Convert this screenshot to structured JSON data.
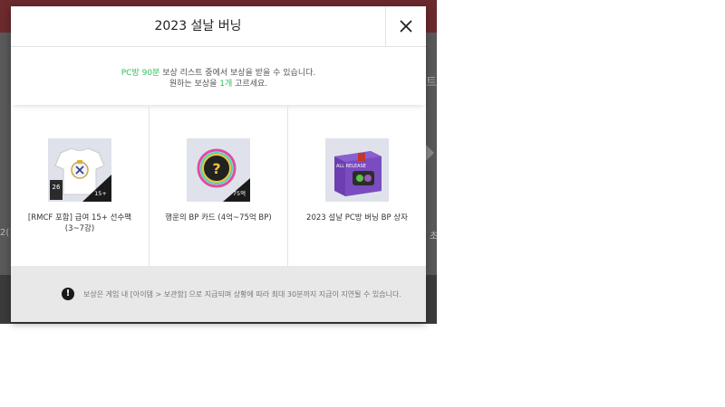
{
  "backdrop": {
    "side_glyph": "트",
    "side_text_left": "2(",
    "side_text_right": "초"
  },
  "modal": {
    "title": "2023 설날 버닝",
    "close_icon": "close-icon",
    "notice": {
      "line1_highlight": "PC방 90분",
      "line1_rest": " 보상 리스트 중에서 보상을 받을 수 있습니다.",
      "line2_prefix": "원하는 보상을 ",
      "line2_highlight": "1개",
      "line2_suffix": " 고르세요."
    },
    "rewards": [
      {
        "label": "[RMCF 포함] 급여 15+ 선수팩 (3~7강)",
        "badge_top": "26",
        "badge_bottom": "15+"
      },
      {
        "label": "행운의 BP 카드 (4억~75억 BP)",
        "badge_bottom": "75억",
        "mark": "?"
      },
      {
        "label": "2023 설날 PC방 버닝 BP 상자",
        "box_text": "ALL RELEASE"
      }
    ],
    "footer": {
      "icon": "!",
      "text": "보상은 게임 내 [아이템 > 보관함] 으로 지급되며 상황에 따라 최대 30분까지 지급이 지연될 수 있습니다."
    }
  },
  "colors": {
    "accent": "#2fbf5b",
    "backdrop": "#3b3b3b",
    "topbar": "#6b2a2e",
    "footer_bg": "#e8e8e8"
  }
}
